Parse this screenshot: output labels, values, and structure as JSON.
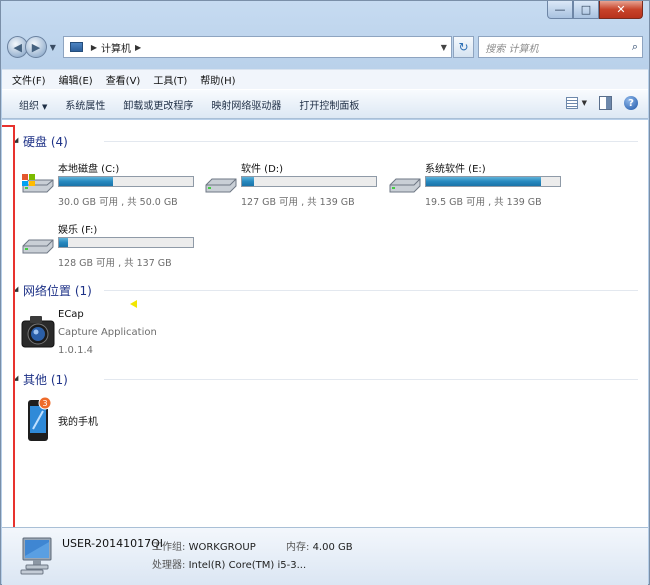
{
  "window": {
    "controls": {
      "minimize": "—",
      "maximize": "□",
      "close": "✕"
    }
  },
  "address_bar": {
    "back": "◀",
    "forward": "▶",
    "path_separator": "▶",
    "path_item": "计算机",
    "path_end_separator": "▶",
    "dropdown": "▼",
    "refresh": "↻",
    "search_placeholder": "搜索 计算机",
    "search_icon": "⌕"
  },
  "menu": [
    "文件(F)",
    "编辑(E)",
    "查看(V)",
    "工具(T)",
    "帮助(H)"
  ],
  "toolbar": {
    "organize": "组织",
    "organize_arrow": "▼",
    "items": [
      "系统属性",
      "卸载或更改程序",
      "映射网络驱动器",
      "打开控制面板"
    ],
    "view_arrow": "▼",
    "help": "?"
  },
  "groups": {
    "hard_disks": {
      "title": "硬盘 (4)"
    },
    "network": {
      "title": "网络位置 (1)"
    },
    "other": {
      "title": "其他 (1)"
    }
  },
  "drives": [
    {
      "name": "本地磁盘 (C:)",
      "info": "30.0 GB 可用 , 共 50.0 GB",
      "used_fraction": 0.4
    },
    {
      "name": "软件 (D:)",
      "info": "127 GB 可用 , 共 139 GB",
      "used_fraction": 0.086
    },
    {
      "name": "系统软件 (E:)",
      "info": "19.5 GB 可用 , 共 139 GB",
      "used_fraction": 0.86
    },
    {
      "name": "娱乐 (F:)",
      "info": "128 GB 可用 , 共 137 GB",
      "used_fraction": 0.066
    }
  ],
  "network_item": {
    "name": "ECap",
    "desc": "Capture Application",
    "version": "1.0.1.4"
  },
  "other_item": {
    "name": "我的手机",
    "badge": "3"
  },
  "status": {
    "computer_name": "USER-20141017QI",
    "workgroup_label": "工作组:",
    "workgroup": "WORKGROUP",
    "memory_label": "内存:",
    "memory": "4.00 GB",
    "cpu_label": "处理器:",
    "cpu": "Intel(R) Core(TM) i5-3..."
  },
  "colors": {
    "drive_fill": "#2688bf",
    "group_title": "#1e3287",
    "highlight_box": "#e8322e"
  }
}
